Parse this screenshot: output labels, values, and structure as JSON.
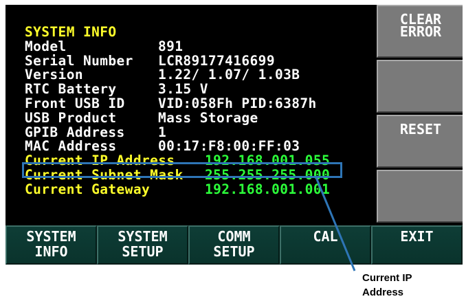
{
  "info_panel": {
    "heading": "SYSTEM INFO",
    "rows": [
      {
        "label": "Model",
        "value": "891"
      },
      {
        "label": "Serial Number",
        "value": "LCR89177416699"
      },
      {
        "label": "Version",
        "value": "1.22/ 1.07/ 1.03B"
      },
      {
        "label": "RTC Battery",
        "value": "3.15 V"
      },
      {
        "label": "Front USB ID",
        "value": "VID:058Fh PID:6387h"
      },
      {
        "label": "USB Product",
        "value": "Mass Storage"
      },
      {
        "label": "GPIB Address",
        "value": "1"
      },
      {
        "label": "MAC Address",
        "value": "00:17:F8:00:FF:03"
      }
    ],
    "network_rows": [
      {
        "label": "Current IP Address",
        "value": "192.168.001.055"
      },
      {
        "label": "Current Subnet Mask",
        "value": "255.255.255.000"
      },
      {
        "label": "Current Gateway",
        "value": "192.168.001.001"
      }
    ]
  },
  "side_buttons": [
    {
      "line1": "CLEAR",
      "line2": "ERROR"
    },
    {
      "line1": "",
      "line2": ""
    },
    {
      "line1": "RESET",
      "line2": ""
    },
    {
      "line1": "",
      "line2": ""
    }
  ],
  "bottom_buttons": [
    {
      "line1": "SYSTEM",
      "line2": "INFO"
    },
    {
      "line1": "SYSTEM",
      "line2": "SETUP"
    },
    {
      "line1": "COMM",
      "line2": "SETUP"
    },
    {
      "line1": "CAL",
      "line2": ""
    },
    {
      "line1": "EXIT",
      "line2": ""
    }
  ],
  "callout": {
    "line1": "Current IP",
    "line2": "Address"
  },
  "colors": {
    "screen_bg": "#000000",
    "heading": "#ffff2a",
    "label": "#ffffff",
    "network_label": "#ffff2a",
    "network_value": "#2cff3a",
    "highlight_border": "#2e75b6",
    "side_button": "#7a7a7a",
    "bottom_button": "#0e3d36"
  }
}
